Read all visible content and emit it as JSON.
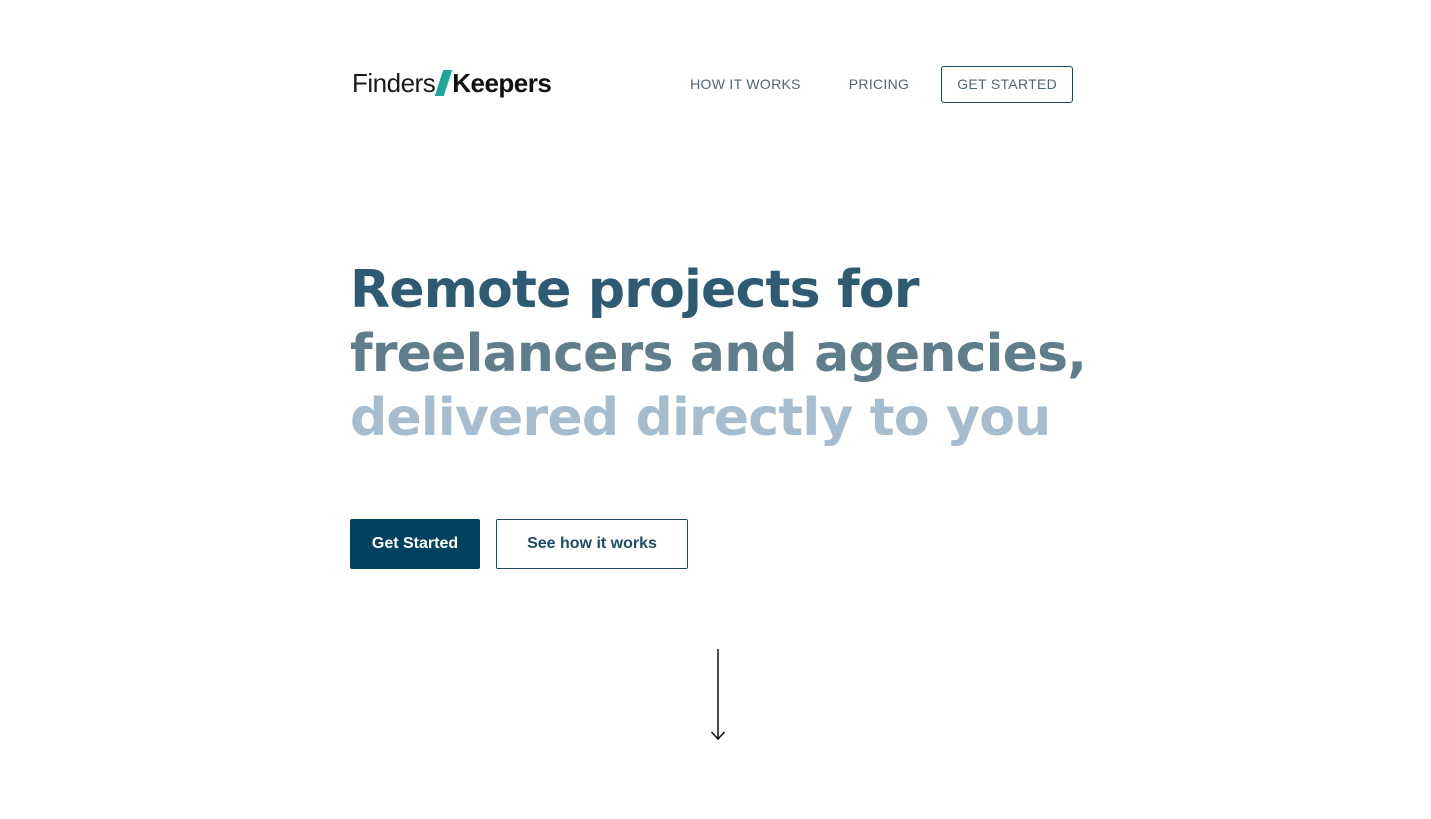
{
  "header": {
    "logo": {
      "part1": "Finders",
      "part2": "Keepers",
      "slash_color": "#1aa89a"
    },
    "nav": {
      "how_it_works": "HOW IT WORKS",
      "pricing": "PRICING",
      "get_started": "GET STARTED"
    }
  },
  "hero": {
    "line1": "Remote projects for",
    "line2": "freelancers and agencies,",
    "line3": "delivered directly to you",
    "colors": {
      "line1": "#2e5a72",
      "line2": "#5f7d8a",
      "line3": "#a6bccf"
    }
  },
  "actions": {
    "primary_label": "Get Started",
    "secondary_label": "See how it works"
  },
  "scroll_indicator": {
    "icon": "arrow-down-icon"
  },
  "colors": {
    "brand_dark": "#03425f",
    "nav_text": "#4d6675"
  }
}
